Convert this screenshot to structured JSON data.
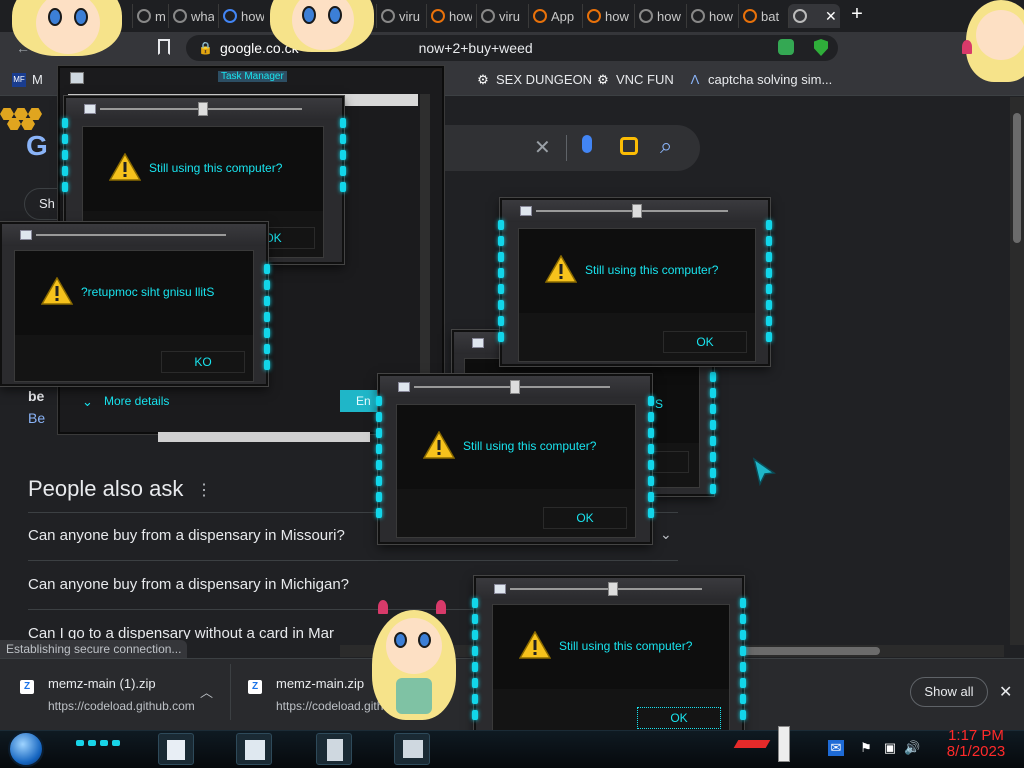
{
  "browser": {
    "tabs": [
      "min",
      "wha",
      "how",
      "viru",
      "how",
      "viru",
      "App",
      "how",
      "how",
      "how",
      "bat"
    ],
    "address": {
      "host": "google.co.ck",
      "path": "now+2+buy+weed"
    },
    "bookmarks": [
      {
        "label": "M",
        "icon": "mft-icon"
      },
      {
        "label": "SEX DUNGEON",
        "icon": "gear-icon"
      },
      {
        "label": "VNC FUN",
        "icon": "gear-icon"
      },
      {
        "label": "captcha solving sim...",
        "icon": "a-logo-icon"
      }
    ]
  },
  "page": {
    "logo_letter": "G",
    "chip_label": "Sh",
    "result_title": "be",
    "result_link": "Be",
    "paa_title": "People also ask",
    "paa_questions": [
      "Can anyone buy from a dispensary in Missouri?",
      "Can anyone buy from a dispensary in Michigan?",
      "Can I go to a dispensary without a card in Mar"
    ]
  },
  "taskmgr": {
    "title": "Task Manager",
    "more_details": "More details",
    "end_task": "En"
  },
  "dialogs": {
    "message": "Still using this computer?",
    "message_reversed": "?retupmoc siht gnisu llitS",
    "ok": "OK",
    "ok_reversed": "KO",
    "partial_letter": "S"
  },
  "downloads": {
    "status": "Establishing secure connection...",
    "items": [
      {
        "name": "memz-main (1).zip",
        "url": "https://codeload.github.com"
      },
      {
        "name": "memz-main.zip",
        "url": "https://codeload.gith"
      }
    ],
    "show_all": "Show all"
  },
  "taskbar": {
    "time": "1:17 PM",
    "date": "8/1/2023"
  },
  "colors": {
    "dialog_text": "#19e4ef",
    "clock": "#ff2a2a",
    "accent_lights": "#12d6ea"
  }
}
